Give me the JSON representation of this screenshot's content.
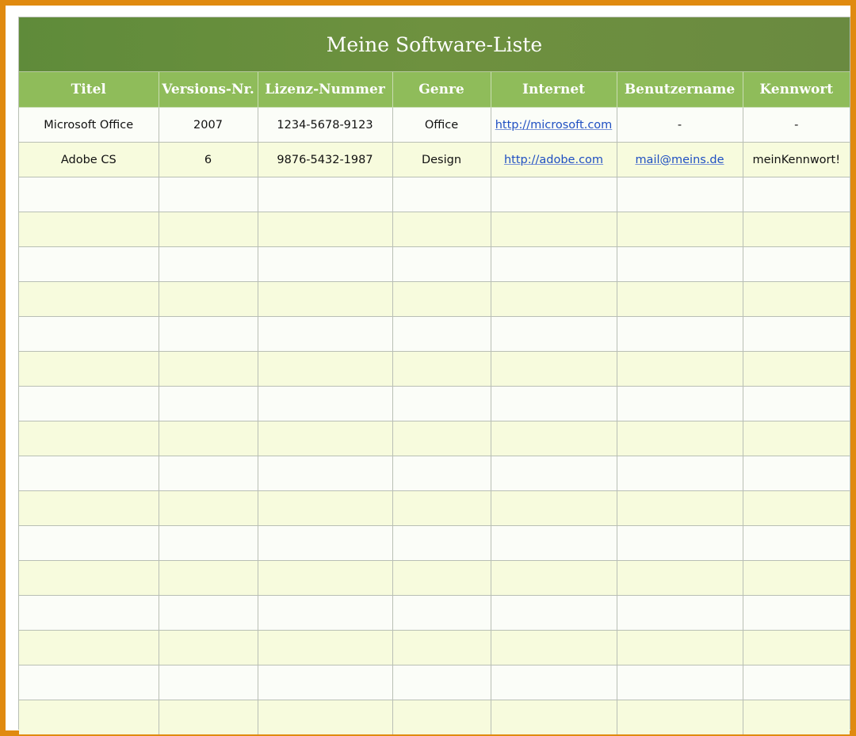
{
  "title": "Meine Software-Liste",
  "columns": [
    "Titel",
    "Versions-Nr.",
    "Lizenz-Nummer",
    "Genre",
    "Internet",
    "Benutzername",
    "Kennwort"
  ],
  "rows": [
    {
      "titel": "Microsoft Office",
      "version": "2007",
      "lizenz": "1234-5678-9123",
      "genre": "Office",
      "internet": "http://microsoft.com",
      "benutzername": "-",
      "kennwort": "-"
    },
    {
      "titel": "Adobe CS",
      "version": "6",
      "lizenz": "9876-5432-1987",
      "genre": "Design",
      "internet": "http://adobe.com",
      "benutzername": "mail@meins.de",
      "kennwort": "meinKennwort!"
    }
  ],
  "empty_row_count": 16,
  "colors": {
    "frame": "#e08a10",
    "title_bg": "#6a8f3d",
    "header_bg": "#8fbc5a",
    "row_alt": "#f7fbdd",
    "link": "#1f4fc2"
  }
}
